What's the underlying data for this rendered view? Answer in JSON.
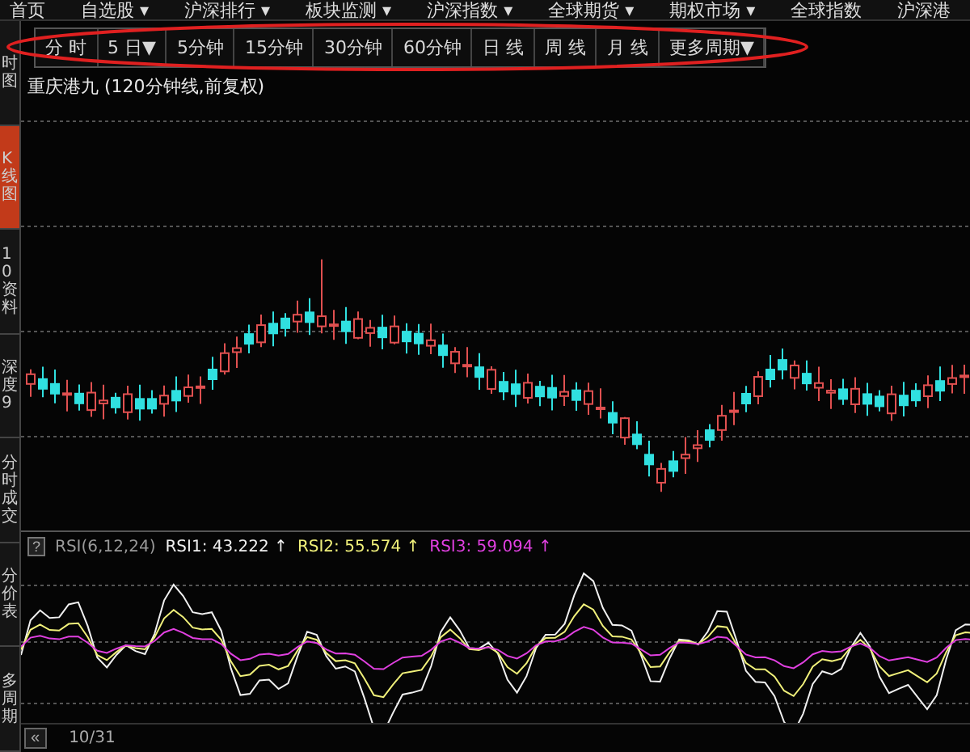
{
  "menu": [
    "首页",
    "自选股 ▾",
    "沪深排行 ▾",
    "板块监测 ▾",
    "沪深指数 ▾",
    "全球期货 ▾",
    "期权市场 ▾",
    "全球指数",
    "沪深港"
  ],
  "sidebar": {
    "items": [
      {
        "label": "时图",
        "selected": false
      },
      {
        "label": "K线图",
        "selected": true
      },
      {
        "label": "10资料",
        "selected": false
      },
      {
        "label": "深度9",
        "selected": false
      },
      {
        "label": "分时成交",
        "selected": false
      },
      {
        "label": "分价表",
        "selected": false
      },
      {
        "label": "多周期",
        "selected": false
      }
    ]
  },
  "periods": [
    "分 时",
    "5 日▼",
    "5分钟",
    "15分钟",
    "30分钟",
    "60分钟",
    "日 线",
    "周 线",
    "月 线",
    "更多周期▼"
  ],
  "chart_title": "重庆港九 (120分钟线,前复权)",
  "indicator": {
    "help": "?",
    "name": "RSI(6,12,24)",
    "readings": [
      {
        "label": "RSI1: 43.222 ↑",
        "color": "#f0f0f0"
      },
      {
        "label": "RSI2: 55.574 ↑",
        "color": "#f0f07a"
      },
      {
        "label": "RSI3: 59.094 ↑",
        "color": "#e040e0"
      }
    ]
  },
  "footer": {
    "scroll": "«",
    "date": "10/31"
  }
}
